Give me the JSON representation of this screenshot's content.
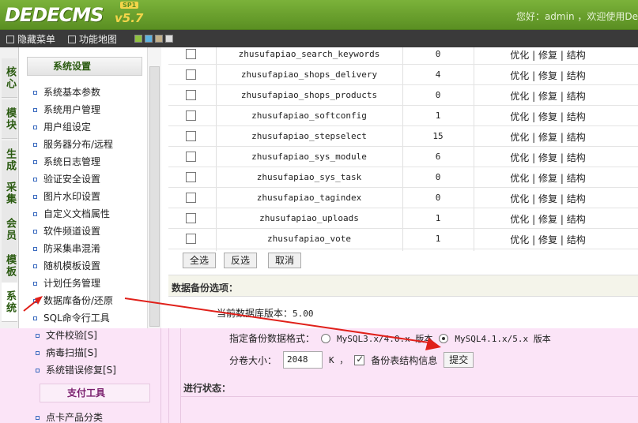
{
  "header": {
    "logo": "DEDECMS",
    "version": "v5.7",
    "sp": "SP1",
    "welcome": "您好：admin ，欢迎使用De"
  },
  "toolbar": {
    "hide_menu": "隐藏菜单",
    "sitemap": "功能地图"
  },
  "vtabs": [
    "核心",
    "模块",
    "生成",
    "采集",
    "会员",
    "模板",
    "系统"
  ],
  "left_menu": {
    "title": "系统设置",
    "items": [
      "系统基本参数",
      "系统用户管理",
      "用户组设定",
      "服务器分布/远程",
      "系统日志管理",
      "验证安全设置",
      "图片水印设置",
      "自定义文档属性",
      "软件频道设置",
      "防采集串混淆",
      "随机模板设置",
      "计划任务管理",
      "数据库备份/还原",
      "SQL命令行工具"
    ]
  },
  "lower_left": {
    "items": [
      "文件校验[S]",
      "病毒扫描[S]",
      "系统错误修复[S]"
    ],
    "section": "支付工具",
    "section_items": [
      "点卡产品分类"
    ]
  },
  "tables": [
    {
      "name": "zhusufapiao_search_keywords",
      "count": "0"
    },
    {
      "name": "zhusufapiao_shops_delivery",
      "count": "4"
    },
    {
      "name": "zhusufapiao_shops_products",
      "count": "0"
    },
    {
      "name": "zhusufapiao_softconfig",
      "count": "1"
    },
    {
      "name": "zhusufapiao_stepselect",
      "count": "15"
    },
    {
      "name": "zhusufapiao_sys_module",
      "count": "6"
    },
    {
      "name": "zhusufapiao_sys_task",
      "count": "0"
    },
    {
      "name": "zhusufapiao_tagindex",
      "count": "0"
    },
    {
      "name": "zhusufapiao_uploads",
      "count": "1"
    },
    {
      "name": "zhusufapiao_vote",
      "count": "1"
    }
  ],
  "actions": {
    "optimize": "优化",
    "repair": "修复",
    "structure": "结构",
    "sep": "|"
  },
  "buttons": {
    "select_all": "全选",
    "invert": "反选",
    "cancel": "取消"
  },
  "backup": {
    "title": "数据备份选项：",
    "db_version_label": "当前数据库版本：",
    "db_version": "5.00",
    "format_label": "指定备份数据格式：",
    "format_opt1": "MySQL3.x/4.0.x 版本",
    "format_opt2": "MySQL4.1.x/5.x 版本",
    "size_label": "分卷大小：",
    "size_value": "2048",
    "size_unit": "K ，",
    "struct_label": "备份表结构信息",
    "submit": "提交",
    "progress": "进行状态："
  },
  "colors": {
    "header_green": "#6aa12e",
    "arrow_red": "#e0201a",
    "pink": "#fbe4f7"
  }
}
